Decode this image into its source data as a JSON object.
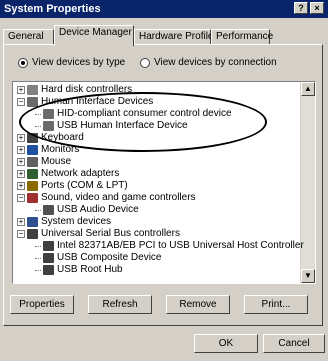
{
  "window": {
    "title": "System Properties",
    "help_btn": "?",
    "close_btn": "×"
  },
  "tabs": [
    "General",
    "Device Manager",
    "Hardware Profiles",
    "Performance"
  ],
  "view": {
    "by_type": "View devices by type",
    "by_connection": "View devices by connection",
    "selected": "by_type"
  },
  "tree": [
    {
      "label": "Hard disk controllers",
      "icon": "disk-controller-icon",
      "expander": "+"
    },
    {
      "label": "Human Interface Devices",
      "icon": "hid-icon",
      "expander": "-"
    },
    {
      "label": "HID-compliant consumer control device",
      "icon": "hid-device-icon"
    },
    {
      "label": "USB Human Interface Device",
      "icon": "hid-device-icon"
    },
    {
      "label": "Keyboard",
      "icon": "keyboard-icon",
      "expander": "+"
    },
    {
      "label": "Monitors",
      "icon": "monitor-icon",
      "expander": "+"
    },
    {
      "label": "Mouse",
      "icon": "mouse-icon",
      "expander": "+"
    },
    {
      "label": "Network adapters",
      "icon": "network-icon",
      "expander": "+"
    },
    {
      "label": "Ports (COM & LPT)",
      "icon": "port-icon",
      "expander": "+"
    },
    {
      "label": "Sound, video and game controllers",
      "icon": "sound-icon",
      "expander": "-"
    },
    {
      "label": "USB Audio Device",
      "icon": "audio-device-icon"
    },
    {
      "label": "System devices",
      "icon": "system-icon",
      "expander": "+"
    },
    {
      "label": "Universal Serial Bus controllers",
      "icon": "usb-icon",
      "expander": "-"
    },
    {
      "label": "Intel 82371AB/EB PCI to USB Universal Host Controller",
      "icon": "usb-icon"
    },
    {
      "label": "USB Composite Device",
      "icon": "usb-icon"
    },
    {
      "label": "USB Root Hub",
      "icon": "usb-icon"
    }
  ],
  "buttons": {
    "properties": "Properties",
    "refresh": "Refresh",
    "remove": "Remove",
    "print": "Print..."
  },
  "footer": {
    "ok": "OK",
    "cancel": "Cancel"
  }
}
